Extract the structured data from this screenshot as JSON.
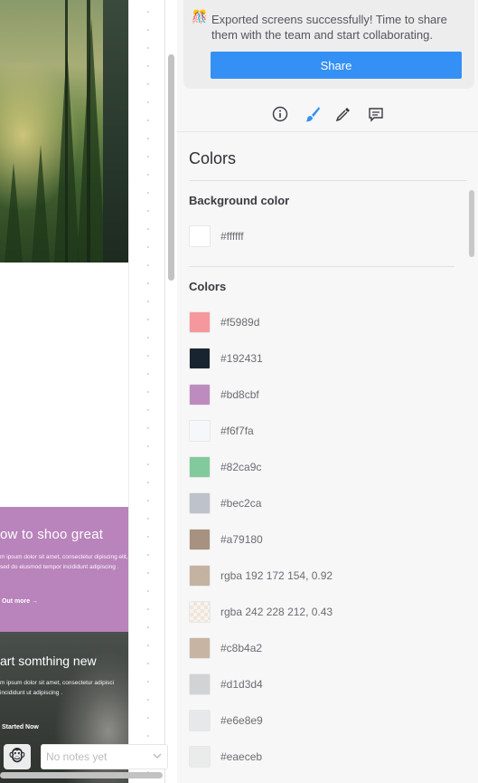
{
  "canvas": {
    "pink_section": {
      "heading": "ow to shoo great",
      "body": "m ipsum dolor sit amet, consectetur dipiscing elit, sed do eiusmod tempor incididunt adipiscing .",
      "link": "Out more  →"
    },
    "dark_section": {
      "heading": "art somthing new",
      "body": "m ipsum dolor sit amet, consectetur adipisci\nincididunt ut adipiscing .",
      "link": "Started Now"
    }
  },
  "notes": {
    "avatar_icon": "monkey-emoji",
    "placeholder": "No notes yet"
  },
  "inspector": {
    "notice": {
      "icon": "party-emoji",
      "text": "Exported screens successfully! Time to share them with the team and start collaborating.",
      "share_label": "Share"
    },
    "tabs": [
      {
        "name": "info",
        "icon": "info-icon"
      },
      {
        "name": "styles",
        "icon": "paintbrush-icon",
        "active": true
      },
      {
        "name": "eyedropper",
        "icon": "eyedropper-icon"
      },
      {
        "name": "comments",
        "icon": "comment-icon"
      }
    ],
    "title": "Colors",
    "background_color": {
      "label": "Background color",
      "value": "#ffffff",
      "swatch": "#ffffff"
    },
    "colors_label": "Colors",
    "colors": [
      {
        "value": "#f5989d",
        "swatch": "#f5989d"
      },
      {
        "value": "#192431",
        "swatch": "#192431"
      },
      {
        "value": "#bd8cbf",
        "swatch": "#bd8cbf"
      },
      {
        "value": "#f6f7fa",
        "swatch": "#f6f7fa"
      },
      {
        "value": "#82ca9c",
        "swatch": "#82ca9c"
      },
      {
        "value": "#bec2ca",
        "swatch": "#bec2ca"
      },
      {
        "value": "#a79180",
        "swatch": "#a79180"
      },
      {
        "value": "rgba 192 172 154, 0.92",
        "swatch": "rgba(192,172,154,0.92)"
      },
      {
        "value": "rgba 242 228 212, 0.43",
        "swatch": "rgba(242,228,212,0.43)"
      },
      {
        "value": "#c8b4a2",
        "swatch": "#c8b4a2"
      },
      {
        "value": "#d1d3d4",
        "swatch": "#d1d3d4"
      },
      {
        "value": "#e6e8e9",
        "swatch": "#e6e8e9"
      },
      {
        "value": "#eaeceb",
        "swatch": "#eaeceb"
      }
    ],
    "accent_color": "#3490f4"
  }
}
